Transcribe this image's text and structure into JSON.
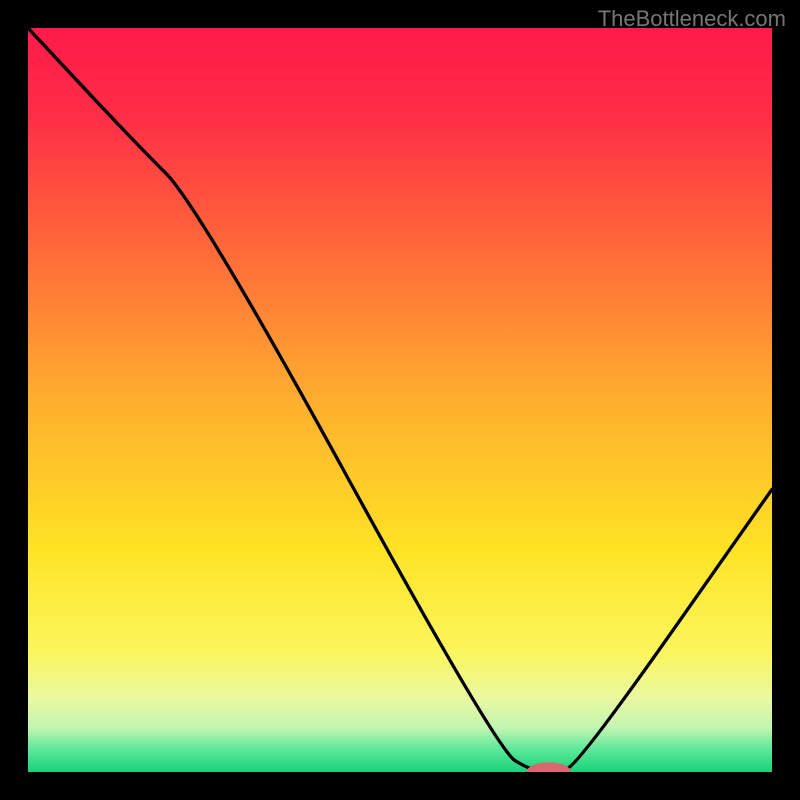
{
  "watermark": "TheBottleneck.com",
  "chart_data": {
    "type": "line",
    "title": "",
    "xlabel": "",
    "ylabel": "",
    "xlim": [
      0,
      100
    ],
    "ylim": [
      0,
      100
    ],
    "background_gradient": {
      "stops": [
        {
          "offset": 0.0,
          "color": "#ff1a4a"
        },
        {
          "offset": 0.12,
          "color": "#ff2e46"
        },
        {
          "offset": 0.3,
          "color": "#ff6a3a"
        },
        {
          "offset": 0.5,
          "color": "#ffae2e"
        },
        {
          "offset": 0.7,
          "color": "#ffe324"
        },
        {
          "offset": 0.84,
          "color": "#fbf65e"
        },
        {
          "offset": 0.9,
          "color": "#eaf8a0"
        },
        {
          "offset": 0.94,
          "color": "#c3f6b2"
        },
        {
          "offset": 0.97,
          "color": "#5be89a"
        },
        {
          "offset": 1.0,
          "color": "#19d27a"
        }
      ]
    },
    "series": [
      {
        "name": "bottleneck-curve",
        "style": "line",
        "color": "#000000",
        "x": [
          0,
          14,
          23,
          63,
          68,
          71,
          74,
          100
        ],
        "y": [
          100,
          85,
          76,
          3,
          0,
          0,
          1,
          38
        ]
      }
    ],
    "marker": {
      "name": "optimal-point",
      "cx": 70,
      "cy": 0,
      "rx": 3.0,
      "ry": 1.3,
      "color": "#d8676e"
    }
  }
}
